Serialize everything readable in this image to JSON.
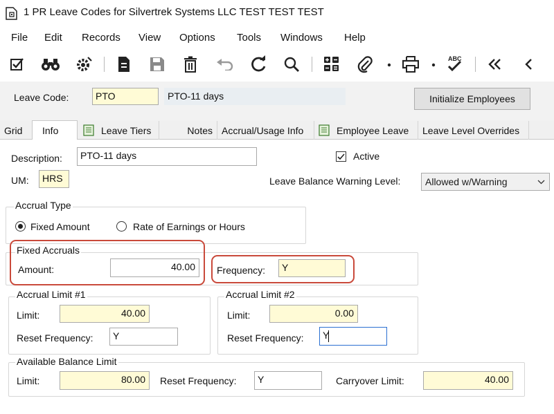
{
  "window": {
    "title": "1 PR Leave Codes for Silvertrek Systems LLC TEST TEST TEST"
  },
  "menu": [
    "File",
    "Edit",
    "Records",
    "View",
    "Options",
    "Tools",
    "Windows",
    "Help"
  ],
  "toolbar": {
    "icons": [
      "edit-check-icon",
      "binoculars-icon",
      "gear-icon",
      "new-document-icon",
      "save-icon",
      "delete-icon",
      "undo-icon",
      "refresh-icon",
      "search-icon",
      "calculator-icon",
      "attachment-icon",
      "print-icon",
      "spellcheck-icon",
      "first-record-icon",
      "previous-record-icon"
    ],
    "spellcheck_text": "ABC"
  },
  "header": {
    "leave_code_label": "Leave Code:",
    "leave_code_value": "PTO",
    "leave_code_description": "PTO-11 days",
    "initialize_button": "Initialize Employees"
  },
  "tabs": [
    "Grid",
    "Info",
    "Leave Tiers",
    "Notes",
    "Accrual/Usage Info",
    "Employee Leave",
    "Leave Level Overrides"
  ],
  "active_tab": "Info",
  "info": {
    "description_label": "Description:",
    "description_value": "PTO-11 days",
    "active_label": "Active",
    "active_checked": true,
    "um_label": "UM:",
    "um_value": "HRS",
    "warning_label": "Leave Balance Warning Level:",
    "warning_value": "Allowed w/Warning"
  },
  "accrual_type": {
    "title": "Accrual Type",
    "options": [
      "Fixed Amount",
      "Rate of Earnings or Hours"
    ],
    "selected": "Fixed Amount"
  },
  "fixed_accruals": {
    "title": "Fixed Accruals",
    "amount_label": "Amount:",
    "amount_value": "40.00",
    "frequency_label": "Frequency:",
    "frequency_value": "Y"
  },
  "accrual_limit_1": {
    "title": "Accrual Limit #1",
    "limit_label": "Limit:",
    "limit_value": "40.00",
    "reset_label": "Reset Frequency:",
    "reset_value": "Y"
  },
  "accrual_limit_2": {
    "title": "Accrual Limit #2",
    "limit_label": "Limit:",
    "limit_value": "0.00",
    "reset_label": "Reset Frequency:",
    "reset_value": "Y"
  },
  "available_balance": {
    "title": "Available Balance Limit",
    "limit_label": "Limit:",
    "limit_value": "80.00",
    "reset_label": "Reset Frequency:",
    "reset_value": "Y",
    "carryover_label": "Carryover Limit:",
    "carryover_value": "40.00"
  },
  "colors": {
    "highlight": "#c9493a",
    "required_field": "#fffbd6",
    "focus_border": "#2a6fd1"
  }
}
